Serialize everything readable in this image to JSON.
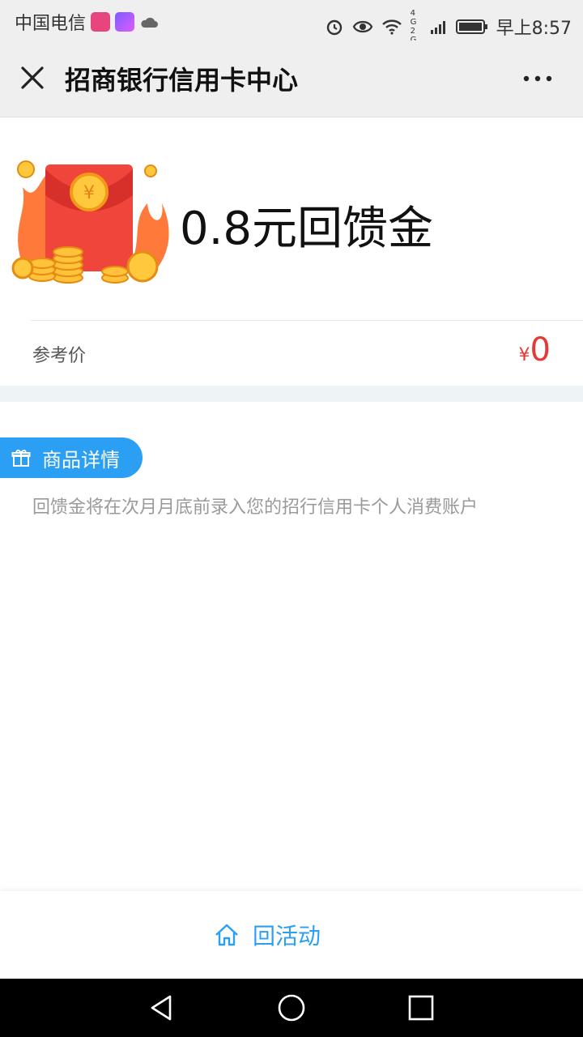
{
  "status_bar": {
    "carrier": "中国电信",
    "time": "早上8:57",
    "network": "4G 2G"
  },
  "header": {
    "title": "招商银行信用卡中心"
  },
  "product": {
    "name": "0.8元回馈金",
    "price_label": "参考价",
    "currency": "¥",
    "price": "0"
  },
  "details": {
    "tag_label": "商品详情",
    "description": "回馈金将在次月月底前录入您的招行信用卡个人消费账户"
  },
  "footer": {
    "back_label": "回活动"
  },
  "colors": {
    "accent": "#2b9ff3",
    "price": "#e53935"
  },
  "icons": [
    "close-icon",
    "more-icon",
    "red-envelope-image",
    "gift-icon",
    "home-icon",
    "back-nav-icon",
    "home-nav-icon",
    "recent-apps-icon"
  ]
}
